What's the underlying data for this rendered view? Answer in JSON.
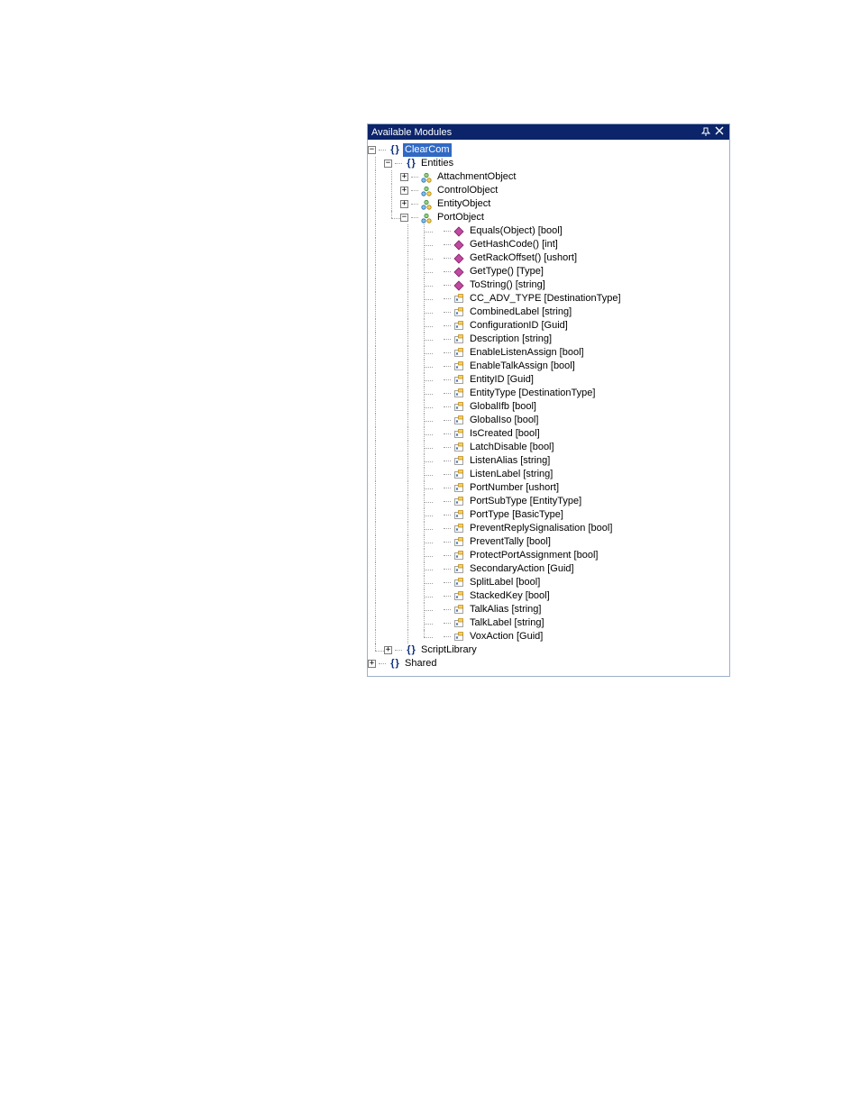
{
  "panel": {
    "title": "Available Modules"
  },
  "tree": {
    "root": {
      "label": "ClearCom",
      "selected": true,
      "expanded": true,
      "children": [
        {
          "id": "entities",
          "label": "Entities",
          "expanded": true,
          "icon": "namespace",
          "children": [
            {
              "id": "attachmentobject",
              "label": "AttachmentObject",
              "icon": "class",
              "expanded": false,
              "hasChildren": true
            },
            {
              "id": "controlobject",
              "label": "ControlObject",
              "icon": "class",
              "expanded": false,
              "hasChildren": true
            },
            {
              "id": "entityobject",
              "label": "EntityObject",
              "icon": "class",
              "expanded": false,
              "hasChildren": true
            },
            {
              "id": "portobject",
              "label": "PortObject",
              "icon": "class",
              "expanded": true,
              "hasChildren": true,
              "children": [
                {
                  "icon": "method",
                  "label": "Equals(Object) [bool]"
                },
                {
                  "icon": "method",
                  "label": "GetHashCode() [int]"
                },
                {
                  "icon": "method",
                  "label": "GetRackOffset() [ushort]"
                },
                {
                  "icon": "method",
                  "label": "GetType() [Type]"
                },
                {
                  "icon": "method",
                  "label": "ToString() [string]"
                },
                {
                  "icon": "property",
                  "label": "CC_ADV_TYPE [DestinationType]"
                },
                {
                  "icon": "property",
                  "label": "CombinedLabel [string]"
                },
                {
                  "icon": "property",
                  "label": "ConfigurationID [Guid]"
                },
                {
                  "icon": "property",
                  "label": "Description [string]"
                },
                {
                  "icon": "property",
                  "label": "EnableListenAssign [bool]"
                },
                {
                  "icon": "property",
                  "label": "EnableTalkAssign [bool]"
                },
                {
                  "icon": "property",
                  "label": "EntityID [Guid]"
                },
                {
                  "icon": "property",
                  "label": "EntityType [DestinationType]"
                },
                {
                  "icon": "property",
                  "label": "GlobalIfb [bool]"
                },
                {
                  "icon": "property",
                  "label": "GlobalIso [bool]"
                },
                {
                  "icon": "property",
                  "label": "IsCreated [bool]"
                },
                {
                  "icon": "property",
                  "label": "LatchDisable [bool]"
                },
                {
                  "icon": "property",
                  "label": "ListenAlias [string]"
                },
                {
                  "icon": "property",
                  "label": "ListenLabel [string]"
                },
                {
                  "icon": "property",
                  "label": "PortNumber [ushort]"
                },
                {
                  "icon": "property",
                  "label": "PortSubType [EntityType]"
                },
                {
                  "icon": "property",
                  "label": "PortType [BasicType]"
                },
                {
                  "icon": "property",
                  "label": "PreventReplySignalisation [bool]"
                },
                {
                  "icon": "property",
                  "label": "PreventTally [bool]"
                },
                {
                  "icon": "property",
                  "label": "ProtectPortAssignment [bool]"
                },
                {
                  "icon": "property",
                  "label": "SecondaryAction [Guid]"
                },
                {
                  "icon": "property",
                  "label": "SplitLabel [bool]"
                },
                {
                  "icon": "property",
                  "label": "StackedKey [bool]"
                },
                {
                  "icon": "property",
                  "label": "TalkAlias [string]"
                },
                {
                  "icon": "property",
                  "label": "TalkLabel [string]"
                },
                {
                  "icon": "property",
                  "label": "VoxAction [Guid]"
                }
              ]
            }
          ]
        },
        {
          "id": "scriptlibrary",
          "label": "ScriptLibrary",
          "icon": "namespace",
          "expanded": false,
          "hasChildren": true
        }
      ]
    },
    "siblings": [
      {
        "id": "shared",
        "label": "Shared",
        "icon": "namespace",
        "expanded": false,
        "hasChildren": true
      }
    ]
  }
}
